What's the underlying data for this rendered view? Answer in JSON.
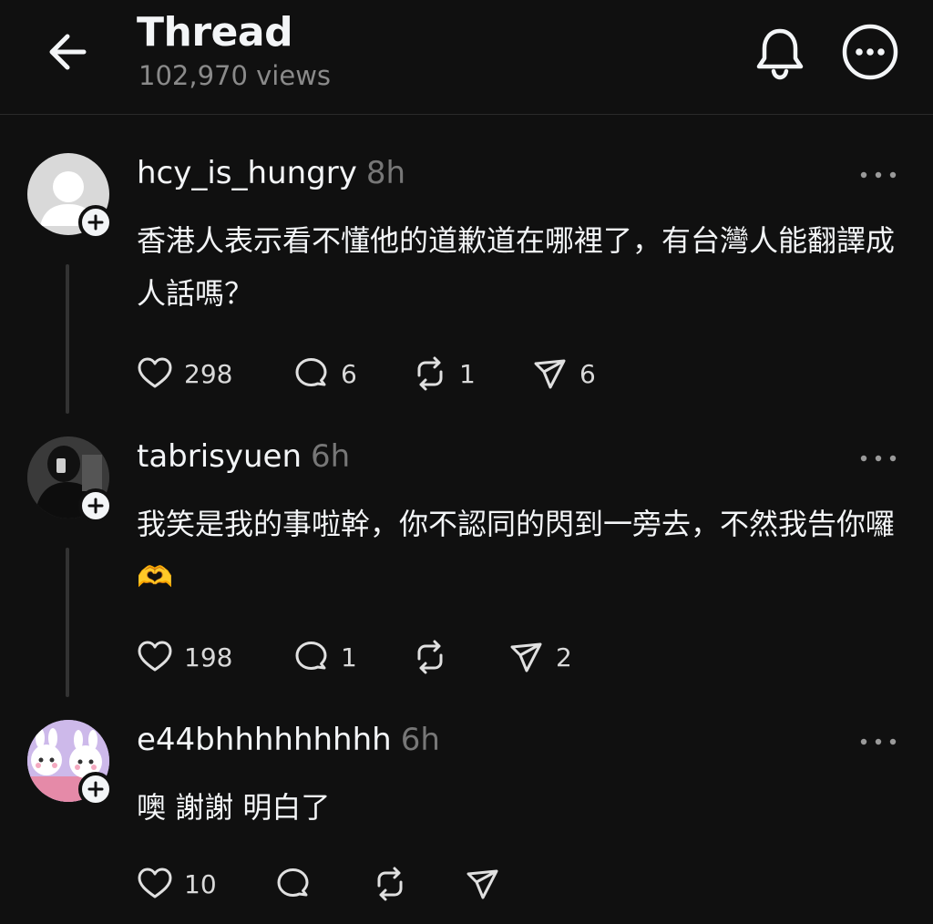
{
  "header": {
    "title": "Thread",
    "views": "102,970 views"
  },
  "posts": [
    {
      "username": "hcy_is_hungry",
      "time": "8h",
      "text": "香港人表示看不懂他的道歉道在哪裡了，有台灣人能翻譯成人話嗎？",
      "likes": "298",
      "replies": "6",
      "reposts": "1",
      "shares": "6"
    },
    {
      "username": "tabrisyuen",
      "time": "6h",
      "text": "我笑是我的事啦幹，你不認同的閃到一旁去，不然我告你囉🫶",
      "likes": "198",
      "replies": "1",
      "reposts": "",
      "shares": "2"
    },
    {
      "username": "e44bhhhhhhhhh",
      "time": "6h",
      "text": "噢 謝謝 明白了",
      "likes": "10",
      "replies": "",
      "reposts": "",
      "shares": ""
    }
  ],
  "colors": {
    "background": "#101010",
    "text": "#f3f5f7",
    "muted": "#777777",
    "thread_line": "#333333"
  },
  "icons": [
    "back-arrow-icon",
    "bell-icon",
    "more-icon",
    "heart-icon",
    "comment-icon",
    "repost-icon",
    "send-icon",
    "plus-icon"
  ]
}
